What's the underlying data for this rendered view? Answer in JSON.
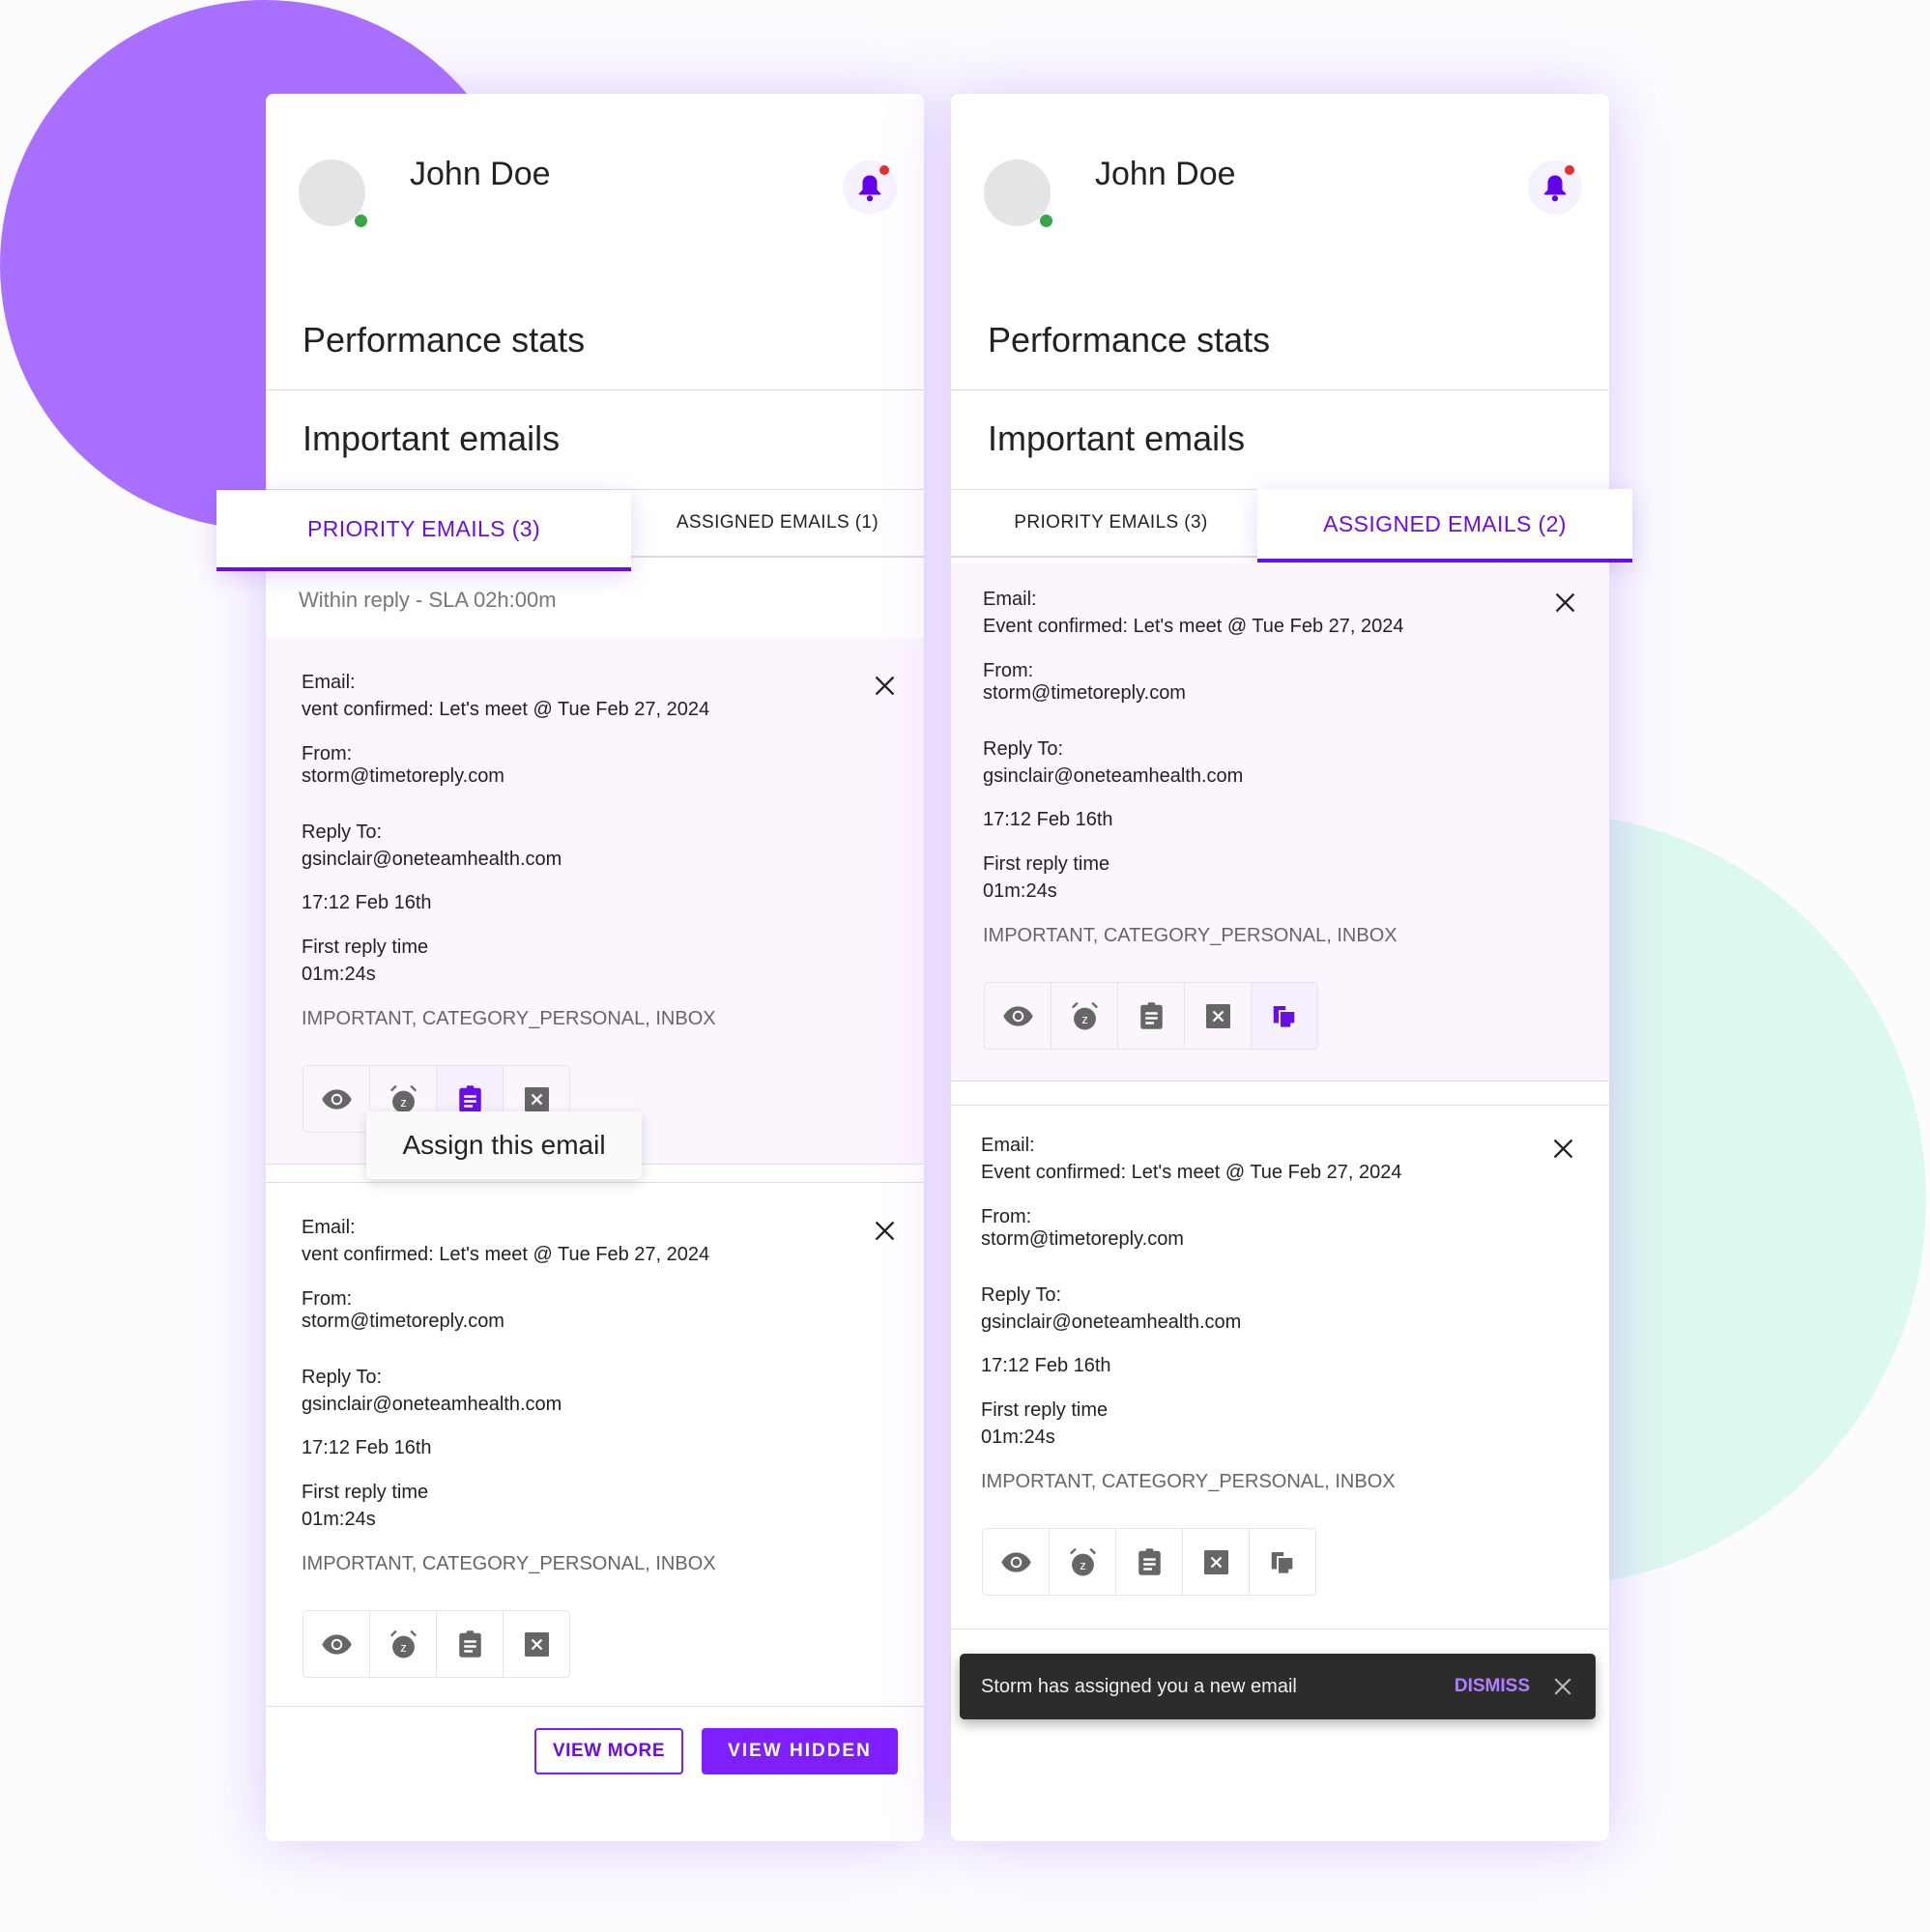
{
  "colors": {
    "accent": "#6a0ee6",
    "button": "#7f1fff",
    "icon_gray": "#666666",
    "highlight_bg": "#fcf5fd",
    "online": "#3aa547",
    "badge": "#e03030"
  },
  "cards": [
    {
      "user": {
        "name": "John Doe",
        "status": "online"
      },
      "sections": {
        "performance": "Performance stats",
        "important": "Important emails"
      },
      "tabs": [
        {
          "label": "PRIORITY EMAILS (3)",
          "active": true
        },
        {
          "label": "ASSIGNED EMAILS (1)",
          "active": false
        }
      ],
      "sla": "Within reply - SLA 02h:00m",
      "emails": [
        {
          "email_label": "Email:",
          "subject": "vent confirmed: Let's meet @ Tue Feb 27, 2024",
          "from_label": "From:",
          "from": "storm@timetoreply.com",
          "reply_to_label": "Reply To:",
          "reply_to": "gsinclair@oneteamhealth.com",
          "time": "17:12 Feb 16th",
          "first_reply_label": "First reply time",
          "first_reply": "01m:24s",
          "tags": "IMPORTANT, CATEGORY_PERSONAL, INBOX",
          "actions": [
            "eye-icon",
            "snooze-icon",
            "assign-icon",
            "hide-icon"
          ],
          "highlighted_action": "assign-icon",
          "highlighted": true
        },
        {
          "email_label": "Email:",
          "subject": "vent confirmed: Let's meet @ Tue Feb 27, 2024",
          "from_label": "From:",
          "from": "storm@timetoreply.com",
          "reply_to_label": "Reply To:",
          "reply_to": "gsinclair@oneteamhealth.com",
          "time": "17:12 Feb 16th",
          "first_reply_label": "First reply time",
          "first_reply": "01m:24s",
          "tags": "IMPORTANT, CATEGORY_PERSONAL, INBOX",
          "actions": [
            "eye-icon",
            "snooze-icon",
            "assign-icon",
            "hide-icon"
          ],
          "highlighted_action": null,
          "highlighted": false
        }
      ],
      "tooltip": "Assign this email",
      "footer": {
        "view_more": "VIEW MORE",
        "view_hidden": "VIEW HIDDEN"
      }
    },
    {
      "user": {
        "name": "John Doe",
        "status": "online"
      },
      "sections": {
        "performance": "Performance stats",
        "important": "Important emails"
      },
      "tabs": [
        {
          "label": "PRIORITY EMAILS (3)",
          "active": false
        },
        {
          "label": "ASSIGNED EMAILS (2)",
          "active": true
        }
      ],
      "emails": [
        {
          "email_label": "Email:",
          "subject": "Event confirmed: Let's meet @ Tue Feb 27, 2024",
          "from_label": "From:",
          "from": "storm@timetoreply.com",
          "reply_to_label": "Reply To:",
          "reply_to": "gsinclair@oneteamhealth.com",
          "time": "17:12 Feb 16th",
          "first_reply_label": "First reply time",
          "first_reply": "01m:24s",
          "tags": "IMPORTANT, CATEGORY_PERSONAL, INBOX",
          "actions": [
            "eye-icon",
            "snooze-icon",
            "assign-icon",
            "hide-icon",
            "copy-icon"
          ],
          "highlighted_action": "copy-icon",
          "highlighted": true
        },
        {
          "email_label": "Email:",
          "subject": "Event confirmed: Let's meet @ Tue Feb 27, 2024",
          "from_label": "From:",
          "from": "storm@timetoreply.com",
          "reply_to_label": "Reply To:",
          "reply_to": "gsinclair@oneteamhealth.com",
          "time": "17:12 Feb 16th",
          "first_reply_label": "First reply time",
          "first_reply": "01m:24s",
          "tags": "IMPORTANT, CATEGORY_PERSONAL, INBOX",
          "actions": [
            "eye-icon",
            "snooze-icon",
            "assign-icon",
            "hide-icon",
            "copy-icon"
          ],
          "highlighted_action": null,
          "highlighted": false
        }
      ],
      "snackbar": {
        "message": "Storm has assigned you a new email",
        "action": "DISMISS"
      }
    }
  ]
}
